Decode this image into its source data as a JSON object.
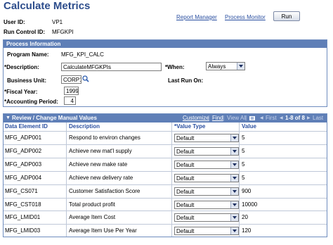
{
  "page": {
    "title": "Calculate Metrics"
  },
  "header": {
    "user_id_label": "User ID:",
    "user_id_value": "VP1",
    "run_control_label": "Run Control ID:",
    "run_control_value": "MFGKPI",
    "report_manager": "Report Manager",
    "process_monitor": "Process Monitor",
    "run_label": "Run"
  },
  "process_info": {
    "section_title": "Process Information",
    "program_name_label": "Program Name:",
    "program_name_value": "MFG_KPI_CALC",
    "description_label": "*Description:",
    "description_value": "CalculateMFGKPIs",
    "when_label": "*When:",
    "when_value": "Always",
    "business_unit_label": "Business Unit:",
    "business_unit_value": "CORP1",
    "last_run_label": "Last Run On:",
    "fiscal_year_label": "*Fiscal Year:",
    "fiscal_year_value": "1999",
    "accounting_period_label": "*Accounting Period:",
    "accounting_period_value": "4"
  },
  "grid": {
    "title": "Review / Change Manual Values",
    "customize": "Customize",
    "find": "Find",
    "view_all": "View All",
    "first": "First",
    "range": "1-8 of 8",
    "last": "Last",
    "columns": [
      "Data Element ID",
      "Description",
      "*Value Type",
      "Value"
    ],
    "rows": [
      {
        "id": "MFG_ADP001",
        "desc": "Respond to environ changes",
        "type": "Default",
        "value": "5"
      },
      {
        "id": "MFG_ADP002",
        "desc": "Achieve new mat'l supply",
        "type": "Default",
        "value": "5"
      },
      {
        "id": "MFG_ADP003",
        "desc": "Achieve new make rate",
        "type": "Default",
        "value": "5"
      },
      {
        "id": "MFG_ADP004",
        "desc": "Achieve new delivery rate",
        "type": "Default",
        "value": "5"
      },
      {
        "id": "MFG_CS071",
        "desc": "Customer Satisfaction Score",
        "type": "Default",
        "value": "900"
      },
      {
        "id": "MFG_CST018",
        "desc": "Total product profit",
        "type": "Default",
        "value": "10000"
      },
      {
        "id": "MFG_LMID01",
        "desc": "Average Item Cost",
        "type": "Default",
        "value": "20"
      },
      {
        "id": "MFG_LMID03",
        "desc": "Average Item Use Per Year",
        "type": "Default",
        "value": "120"
      }
    ]
  }
}
